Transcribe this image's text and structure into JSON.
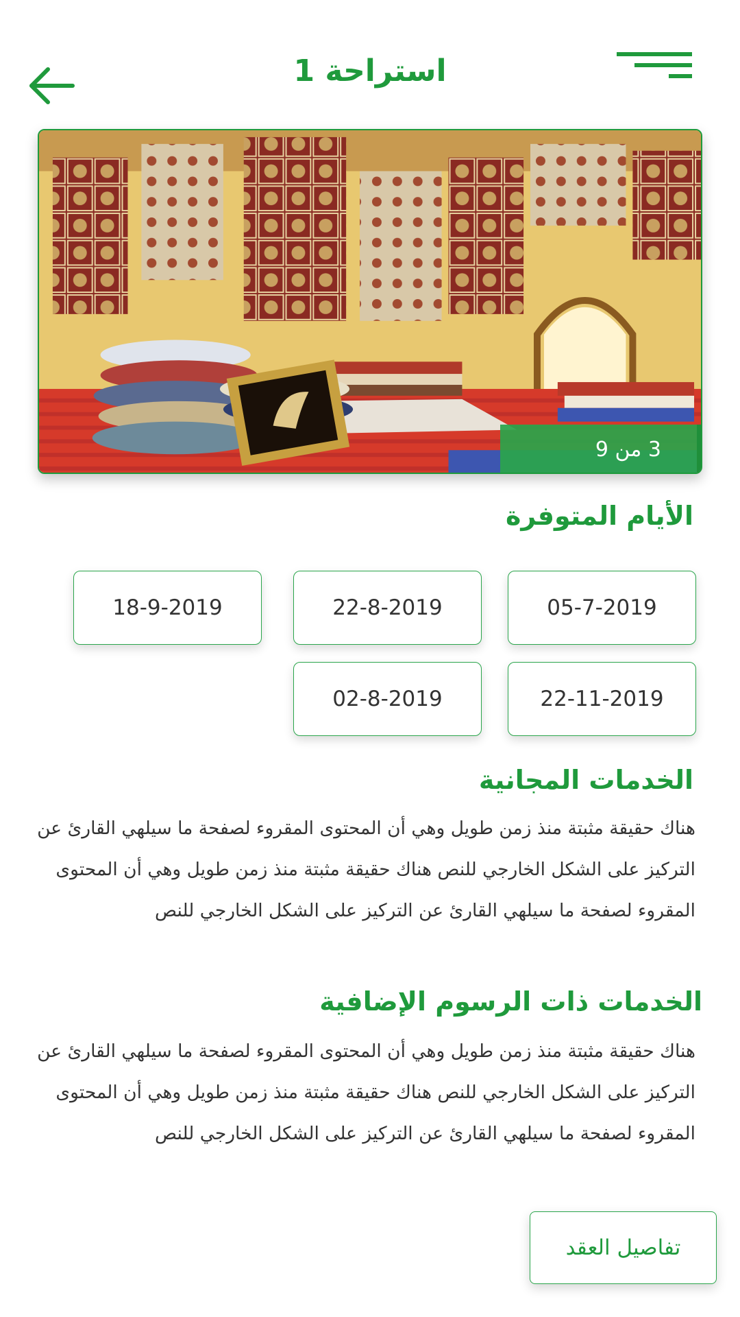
{
  "header": {
    "title": "استراحة 1",
    "back_icon": "arrow-left-icon",
    "menu_icon": "hamburger-menu-icon",
    "accent_color": "#1f9a3c"
  },
  "gallery": {
    "counter_text": "3 من 9"
  },
  "available_days": {
    "title": "الأيام المتوفرة",
    "dates": [
      "05-7-2019",
      "22-8-2019",
      "18-9-2019",
      "22-11-2019",
      "02-8-2019"
    ]
  },
  "free_services": {
    "title": "الخدمات المجانية",
    "text": "هناك حقيقة مثبتة منذ زمن طويل وهي أن المحتوى المقروء لصفحة ما سيلهي القارئ عن التركيز على الشكل الخارجي للنص هناك حقيقة مثبتة منذ زمن طويل وهي أن المحتوى المقروء لصفحة ما سيلهي القارئ عن التركيز على الشكل الخارجي للنص"
  },
  "paid_services": {
    "title": "الخدمات ذات الرسوم الإضافية",
    "text": "هناك حقيقة مثبتة منذ زمن طويل وهي أن المحتوى المقروء لصفحة ما سيلهي القارئ عن التركيز على الشكل الخارجي للنص هناك حقيقة مثبتة منذ زمن طويل وهي أن المحتوى المقروء لصفحة ما سيلهي القارئ عن التركيز على الشكل الخارجي للنص"
  },
  "contract_button": {
    "label": "تفاصيل العقد"
  }
}
